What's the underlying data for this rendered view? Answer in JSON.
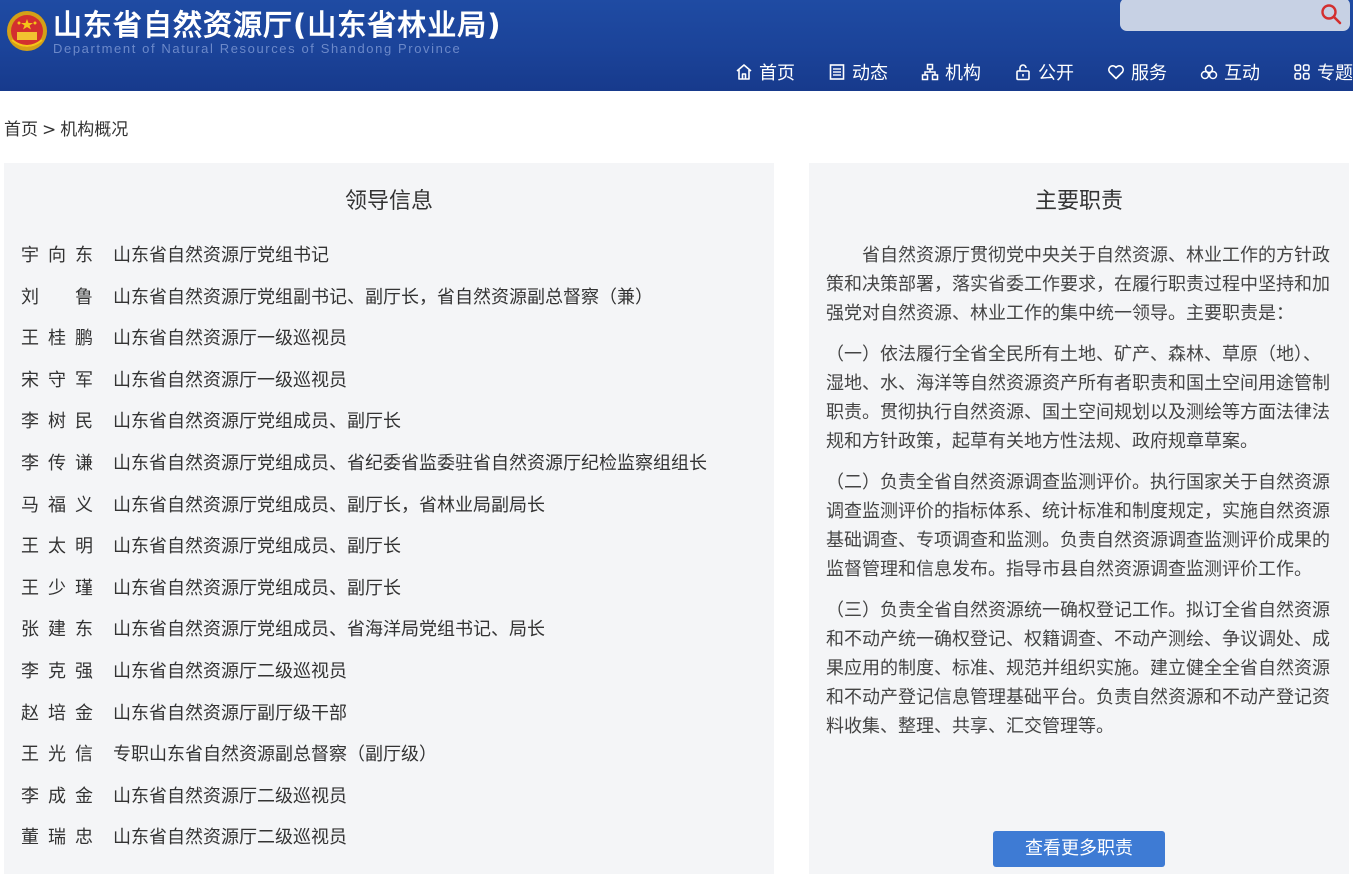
{
  "header": {
    "title": "山东省自然资源厅(山东省林业局)",
    "subtitle": "Department of Natural Resources of Shandong Province",
    "nav": [
      {
        "label": "首页",
        "icon": "home-icon"
      },
      {
        "label": "动态",
        "icon": "news-icon"
      },
      {
        "label": "机构",
        "icon": "org-icon"
      },
      {
        "label": "公开",
        "icon": "lock-icon"
      },
      {
        "label": "服务",
        "icon": "heart-icon"
      },
      {
        "label": "互动",
        "icon": "interact-icon"
      },
      {
        "label": "专题",
        "icon": "grid-icon"
      }
    ]
  },
  "breadcrumb": {
    "home": "首页",
    "separator": ">",
    "current": "机构概况"
  },
  "leaders": {
    "title": "领导信息",
    "items": [
      {
        "name": "宇向东",
        "title": "山东省自然资源厅党组书记"
      },
      {
        "name": "刘鲁",
        "title": "山东省自然资源厅党组副书记、副厅长，省自然资源副总督察（兼）"
      },
      {
        "name": "王桂鹏",
        "title": "山东省自然资源厅一级巡视员"
      },
      {
        "name": "宋守军",
        "title": "山东省自然资源厅一级巡视员"
      },
      {
        "name": "李树民",
        "title": "山东省自然资源厅党组成员、副厅长"
      },
      {
        "name": "李传谦",
        "title": "山东省自然资源厅党组成员、省纪委省监委驻省自然资源厅纪检监察组组长"
      },
      {
        "name": "马福义",
        "title": "山东省自然资源厅党组成员、副厅长，省林业局副局长"
      },
      {
        "name": "王太明",
        "title": "山东省自然资源厅党组成员、副厅长"
      },
      {
        "name": "王少瑾",
        "title": "山东省自然资源厅党组成员、副厅长"
      },
      {
        "name": "张建东",
        "title": "山东省自然资源厅党组成员、省海洋局党组书记、局长"
      },
      {
        "name": "李克强",
        "title": "山东省自然资源厅二级巡视员"
      },
      {
        "name": "赵培金",
        "title": "山东省自然资源厅副厅级干部"
      },
      {
        "name": "王光信",
        "title": "专职山东省自然资源副总督察（副厅级）"
      },
      {
        "name": "李成金",
        "title": "山东省自然资源厅二级巡视员"
      },
      {
        "name": "董瑞忠",
        "title": "山东省自然资源厅二级巡视员"
      }
    ]
  },
  "duties": {
    "title": "主要职责",
    "paragraphs": [
      "省自然资源厅贯彻党中央关于自然资源、林业工作的方针政策和决策部署，落实省委工作要求，在履行职责过程中坚持和加强党对自然资源、林业工作的集中统一领导。主要职责是：",
      "（一）依法履行全省全民所有土地、矿产、森林、草原（地）、湿地、水、海洋等自然资源资产所有者职责和国土空间用途管制职责。贯彻执行自然资源、国土空间规划以及测绘等方面法律法规和方针政策，起草有关地方性法规、政府规章草案。",
      "（二）负责全省自然资源调查监测评价。执行国家关于自然资源调查监测评价的指标体系、统计标准和制度规定，实施自然资源基础调查、专项调查和监测。负责自然资源调查监测评价成果的监督管理和信息发布。指导市县自然资源调查监测评价工作。",
      "（三）负责全省自然资源统一确权登记工作。拟订全省自然资源和不动产统一确权登记、权籍调查、不动产测绘、争议调处、成果应用的制度、标准、规范并组织实施。建立健全全省自然资源和不动产登记信息管理基础平台。负责自然资源和不动产登记资料收集、整理、共享、汇交管理等。"
    ],
    "more_label": "查看更多职责"
  }
}
